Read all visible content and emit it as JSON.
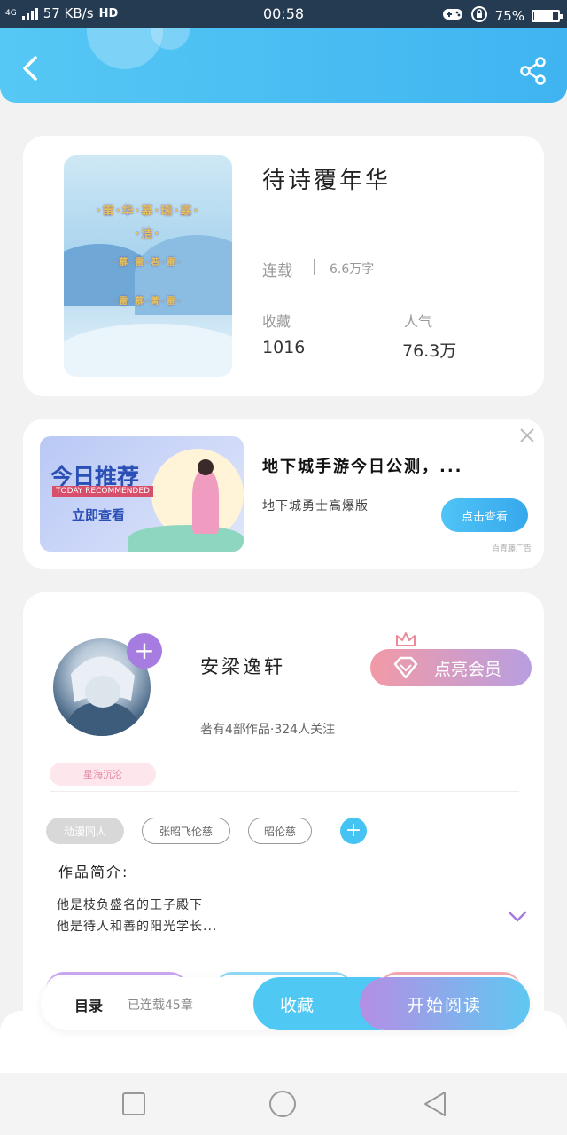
{
  "status_bar": {
    "network": "4G",
    "speed": "57 KB/s",
    "hd": "HD",
    "time": "00:58",
    "battery": "75%",
    "battery_level": 0.75
  },
  "header": {
    "back_icon": "chevron-left-icon",
    "share_icon": "share-icon",
    "accent": "#4cc0f3"
  },
  "book": {
    "title": "待诗覆年华",
    "status": "连载",
    "words": "6.6万字",
    "stats": [
      {
        "label": "收藏",
        "value": "1016"
      },
      {
        "label": "人气",
        "value": "76.3万"
      }
    ]
  },
  "ad": {
    "image_title": "今日推荐",
    "image_tag": "TODAY RECOMMENDED",
    "image_cta": "立即查看",
    "title": "地下城手游今日公测，...",
    "subtitle": "地下城勇士高爆版",
    "button": "点击查看",
    "source": "百青藤广告",
    "close_icon": "close-icon"
  },
  "author": {
    "name": "安梁逸轩",
    "meta": "著有4部作品·324人关注",
    "vip_button": "点亮会员",
    "fan_badge": "星海沉沦",
    "tags": [
      "动漫同人",
      "张昭飞伦慈",
      "昭伦慈"
    ],
    "intro_label": "作品简介:",
    "intro_lines": [
      "他是枝负盛名的王子殿下",
      "他是待人和善的阳光学长..."
    ],
    "colors": {
      "vip_start": "#f29aa6",
      "vip_end": "#b89ee0",
      "avatar_add": "#a77ce0"
    }
  },
  "bottom_bar": {
    "toc": "目录",
    "chapters": "已连载45章",
    "collect": "收藏",
    "read": "开始阅读"
  },
  "nav": {
    "recent_icon": "square-icon",
    "home_icon": "circle-icon",
    "back_icon": "triangle-back-icon"
  }
}
